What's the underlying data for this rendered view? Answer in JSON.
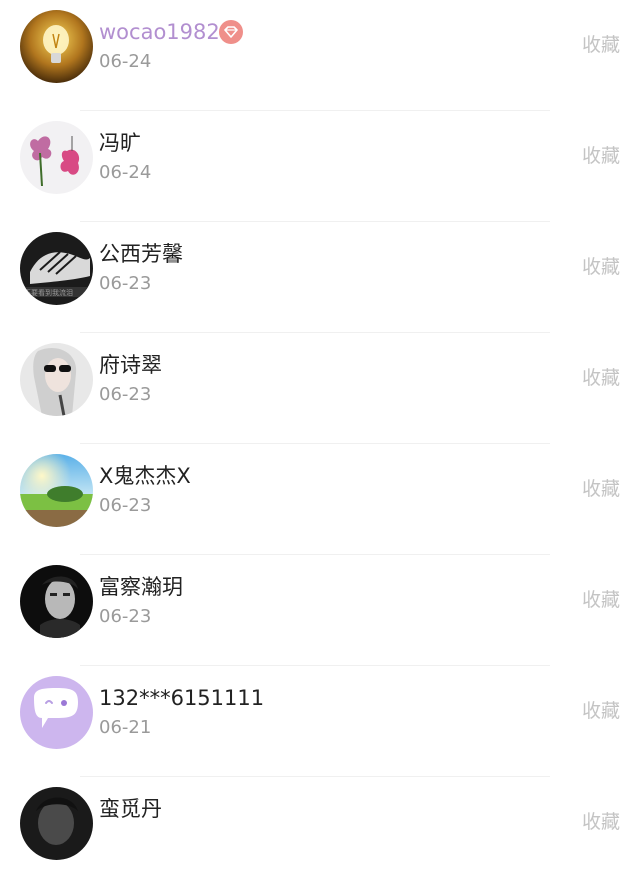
{
  "rows": [
    {
      "name": "wocao1982",
      "date": "06-24",
      "action": "收藏",
      "vip": true,
      "avatar_icon": "lightbulb-avatar"
    },
    {
      "name": "冯旷",
      "date": "06-24",
      "action": "收藏",
      "avatar_icon": "flower-avatar"
    },
    {
      "name": "公西芳馨",
      "date": "06-23",
      "action": "收藏",
      "avatar_icon": "hands-avatar"
    },
    {
      "name": "府诗翠",
      "date": "06-23",
      "action": "收藏",
      "avatar_icon": "sunglasses-portrait-avatar"
    },
    {
      "name": "X鬼杰杰X",
      "date": "06-23",
      "action": "收藏",
      "avatar_icon": "landscape-avatar"
    },
    {
      "name": "富察瀚玥",
      "date": "06-23",
      "action": "收藏",
      "avatar_icon": "dark-portrait-avatar"
    },
    {
      "name": "132***6151111",
      "date": "06-21",
      "action": "收藏",
      "avatar_icon": "chat-bubble-avatar"
    },
    {
      "name": "蛮觅丹",
      "date": "",
      "action": "收藏",
      "avatar_icon": "dark-portrait-avatar-2"
    }
  ],
  "colors": {
    "vip_name": "#b28fd0",
    "vip_badge": "#ef8f8a",
    "secondary_text": "#9a9a9a",
    "action_text": "#c4c4c4"
  }
}
